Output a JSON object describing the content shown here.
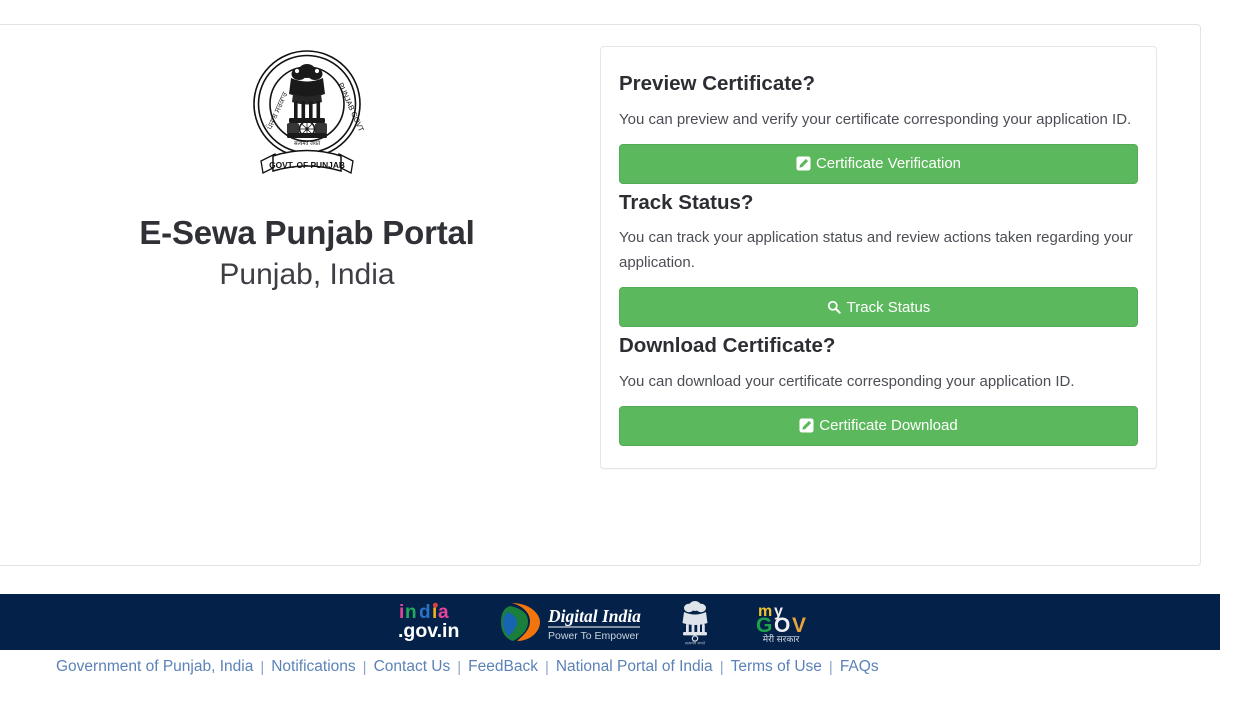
{
  "brand": {
    "emblem_icon": "punjab-government-emblem",
    "emblem_ribbon_text": "GOVT. OF PUNJAB",
    "title": "E-Sewa Punjab Portal",
    "subtitle": "Punjab, India"
  },
  "card": {
    "sections": [
      {
        "title": "Preview Certificate?",
        "description": "You can preview and verify your certificate corresponding your application ID.",
        "button_label": "Certificate Verification",
        "button_icon": "pen-square-icon"
      },
      {
        "title": "Track Status?",
        "description": "You can track your application status and review actions taken regarding your application.",
        "button_label": "Track Status",
        "button_icon": "search-icon"
      },
      {
        "title": "Download Certificate?",
        "description": "You can download your certificate corresponding your application ID.",
        "button_label": "Certificate Download",
        "button_icon": "pen-square-icon"
      }
    ]
  },
  "footer": {
    "logos": [
      {
        "name": "india-gov-in-logo",
        "text": "india.gov.in"
      },
      {
        "name": "digital-india-logo",
        "text": "Digital India",
        "tagline": "Power To Empower"
      },
      {
        "name": "ashoka-emblem-logo",
        "text": "Government of India"
      },
      {
        "name": "mygov-logo",
        "text": "myGov",
        "tagline": "मेरी सरकार"
      }
    ],
    "links": [
      {
        "label": "Government of Punjab, India"
      },
      {
        "label": "Notifications"
      },
      {
        "label": "Contact Us"
      },
      {
        "label": "FeedBack"
      },
      {
        "label": "National Portal of India"
      },
      {
        "label": "Terms of Use"
      },
      {
        "label": "FAQs"
      }
    ],
    "separator": "|"
  },
  "colors": {
    "button_green": "#5cb85c",
    "footer_navy": "#042149",
    "link_blue": "#5b82b8",
    "heading_dark": "#2c2e33",
    "body_text": "#4c4e55"
  }
}
